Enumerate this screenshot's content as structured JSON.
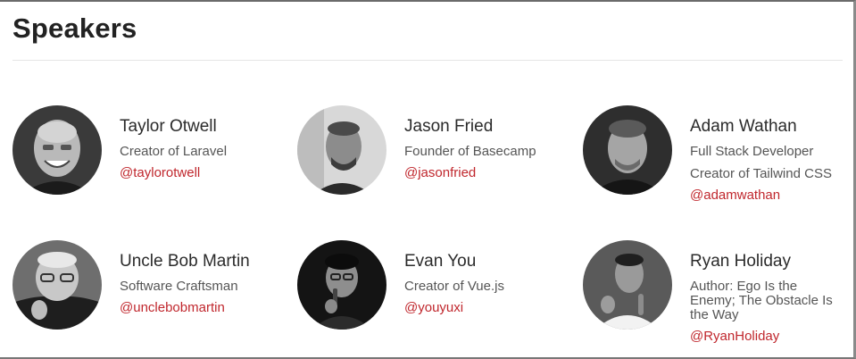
{
  "page_title": "Speakers",
  "colors": {
    "handle": "#c0272d",
    "text": "#2b2b2b",
    "muted": "#555555"
  },
  "speakers": [
    {
      "name": "Taylor Otwell",
      "roles": [
        "Creator of Laravel"
      ],
      "handle": "@taylorotwell",
      "avatar": "photo-taylor-otwell"
    },
    {
      "name": "Jason Fried",
      "roles": [
        "Founder of Basecamp"
      ],
      "handle": "@jasonfried",
      "avatar": "photo-jason-fried"
    },
    {
      "name": "Adam Wathan",
      "roles": [
        "Full Stack Developer",
        "Creator of Tailwind CSS"
      ],
      "handle": "@adamwathan",
      "avatar": "photo-adam-wathan"
    },
    {
      "name": "Uncle Bob Martin",
      "roles": [
        "Software Craftsman"
      ],
      "handle": "@unclebobmartin",
      "avatar": "photo-uncle-bob-martin"
    },
    {
      "name": "Evan You",
      "roles": [
        "Creator of Vue.js"
      ],
      "handle": "@youyuxi",
      "avatar": "photo-evan-you"
    },
    {
      "name": "Ryan Holiday",
      "roles": [
        "Author: Ego Is the Enemy; The Obstacle Is the Way"
      ],
      "handle": "@RyanHoliday",
      "avatar": "photo-ryan-holiday"
    }
  ]
}
